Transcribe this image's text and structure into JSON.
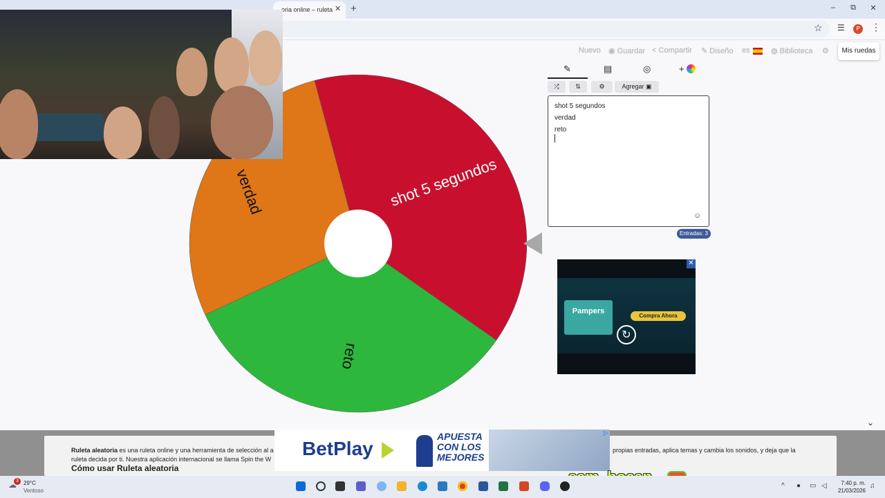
{
  "browser": {
    "tab_title": "oria online – ruleta",
    "tab_close": "✕",
    "new_tab": "+",
    "win_min": "–",
    "win_restore": "⧉",
    "win_close": "✕",
    "star": "☆",
    "profile_initial": "P",
    "menu": "⋮"
  },
  "toolbar": {
    "new": "Nuevo",
    "save": "Guardar",
    "share": "Compartir",
    "design": "Diseño",
    "lang": "es",
    "library": "Biblioteca",
    "my_wheels": "Mis ruedas"
  },
  "editor": {
    "tab_edit_icon": "✎",
    "tab_results_icon": "▤",
    "tab_hide_icon": "◎",
    "tab_add_icon": "+",
    "shuffle_icon": "⤮",
    "sort_icon": "⇅",
    "settings_icon": "⚙",
    "add_label": "Agregar",
    "entries": [
      "shot 5 segundos",
      "verdad",
      "reto"
    ],
    "emoji_icon": "☺",
    "count_label": "Entradas: 3"
  },
  "wheel": {
    "segments": [
      {
        "label": "shot 5 segundos",
        "color": "#c8102e"
      },
      {
        "label": "reto",
        "color": "#2db83d"
      },
      {
        "label": "verdad",
        "color": "#df7617"
      }
    ]
  },
  "ad": {
    "brand": "Pampers",
    "cta": "Compra Ahora",
    "close": "✕",
    "replay": "↻"
  },
  "description": {
    "left_bold": "Ruleta aleatoria",
    "left_text": " es una ruleta online y una herramienta de selección al a",
    "left_line2": "ruleta decida por ti. Nuestra aplicación internacional se llama Spin the W",
    "left_heading": "Cómo usar Ruleta aleatoria",
    "right_text": "propias entradas, aplica temas y cambia los sonidos, y deja que la"
  },
  "betplay": {
    "logo": "BetPlay",
    "slogan": "APUESTA CON LOS MEJORES"
  },
  "streamer": "sam_bocan",
  "taskbar": {
    "badge": "3",
    "temp": "29°C",
    "weather": "Ventoso",
    "time": "7:40 p. m.",
    "date": "21/03/2026"
  }
}
